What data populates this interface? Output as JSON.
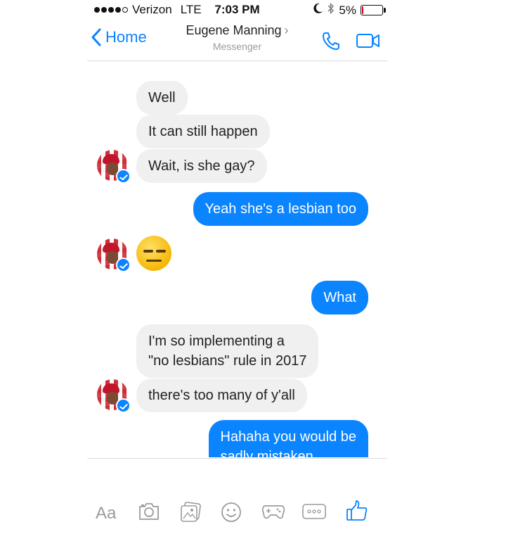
{
  "status_bar": {
    "carrier": "Verizon",
    "network": "LTE",
    "time": "7:03 PM",
    "battery_text": "5%",
    "battery_level": 0.05,
    "battery_color": "#d0021b"
  },
  "nav": {
    "back_label": "Home",
    "contact_name": "Eugene Manning",
    "subtitle": "Messenger",
    "icons": [
      "chevron-left-icon",
      "phone-icon",
      "video-camera-icon"
    ]
  },
  "messages": [
    {
      "sender": "them",
      "text": "Well"
    },
    {
      "sender": "them",
      "text": "It can still happen"
    },
    {
      "sender": "them",
      "text": "Wait, is she gay?"
    },
    {
      "sender": "me",
      "text": "Yeah she's a lesbian too"
    },
    {
      "sender": "them",
      "emoji": "expressionless-face-emoji"
    },
    {
      "sender": "me",
      "text": "What"
    },
    {
      "sender": "them",
      "lines": [
        "I'm so implementing a",
        "\"no lesbians\" rule in 2017"
      ]
    },
    {
      "sender": "them",
      "text": "there's too many of y'all"
    },
    {
      "sender": "me",
      "lines": [
        "Hahaha you would be",
        "sadly mistaken"
      ]
    }
  ],
  "compose": {
    "placeholder": "Aa",
    "tools": [
      "camera-icon",
      "gallery-icon",
      "emoji-icon",
      "game-controller-icon",
      "more-icon",
      "thumbs-up-icon"
    ]
  },
  "colors": {
    "accent": "#0a84ff",
    "incoming_bubble": "#f0f0f0",
    "outgoing_bubble": "#0a84ff"
  }
}
